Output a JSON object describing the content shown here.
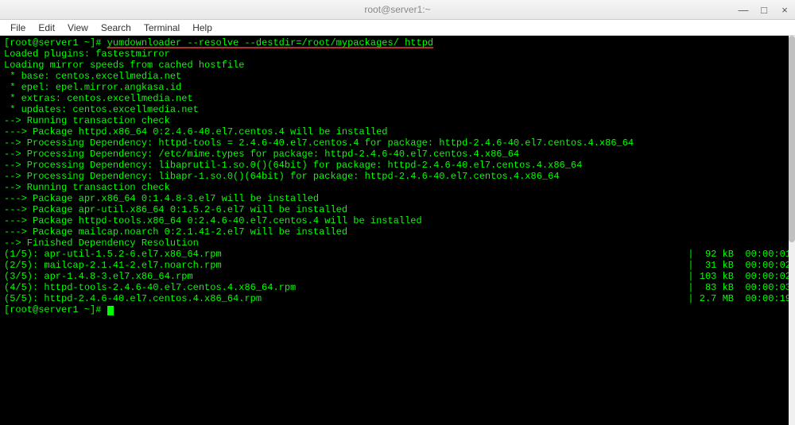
{
  "titlebar": {
    "text": "root@server1:~"
  },
  "window_controls": {
    "minimize": "—",
    "maximize": "□",
    "close": "×"
  },
  "menubar": {
    "items": [
      "File",
      "Edit",
      "View",
      "Search",
      "Terminal",
      "Help"
    ]
  },
  "terminal": {
    "prompt1": "[root@server1 ~]# ",
    "command": "yumdownloader --resolve --destdir=/root/mypackages/ httpd",
    "lines": [
      "Loaded plugins: fastestmirror",
      "Loading mirror speeds from cached hostfile",
      " * base: centos.excellmedia.net",
      " * epel: epel.mirror.angkasa.id",
      " * extras: centos.excellmedia.net",
      " * updates: centos.excellmedia.net",
      "--> Running transaction check",
      "---> Package httpd.x86_64 0:2.4.6-40.el7.centos.4 will be installed",
      "--> Processing Dependency: httpd-tools = 2.4.6-40.el7.centos.4 for package: httpd-2.4.6-40.el7.centos.4.x86_64",
      "--> Processing Dependency: /etc/mime.types for package: httpd-2.4.6-40.el7.centos.4.x86_64",
      "--> Processing Dependency: libaprutil-1.so.0()(64bit) for package: httpd-2.4.6-40.el7.centos.4.x86_64",
      "--> Processing Dependency: libapr-1.so.0()(64bit) for package: httpd-2.4.6-40.el7.centos.4.x86_64",
      "--> Running transaction check",
      "---> Package apr.x86_64 0:1.4.8-3.el7 will be installed",
      "---> Package apr-util.x86_64 0:1.5.2-6.el7 will be installed",
      "---> Package httpd-tools.x86_64 0:2.4.6-40.el7.centos.4 will be installed",
      "---> Package mailcap.noarch 0:2.1.41-2.el7 will be installed",
      "--> Finished Dependency Resolution"
    ],
    "downloads": [
      {
        "left": "(1/5): apr-util-1.5.2-6.el7.x86_64.rpm",
        "right": "|  92 kB  00:00:01"
      },
      {
        "left": "(2/5): mailcap-2.1.41-2.el7.noarch.rpm",
        "right": "|  31 kB  00:00:02"
      },
      {
        "left": "(3/5): apr-1.4.8-3.el7.x86_64.rpm",
        "right": "| 103 kB  00:00:02"
      },
      {
        "left": "(4/5): httpd-tools-2.4.6-40.el7.centos.4.x86_64.rpm",
        "right": "|  83 kB  00:00:03"
      },
      {
        "left": "(5/5): httpd-2.4.6-40.el7.centos.4.x86_64.rpm",
        "right": "| 2.7 MB  00:00:19"
      }
    ],
    "prompt2": "[root@server1 ~]# "
  }
}
